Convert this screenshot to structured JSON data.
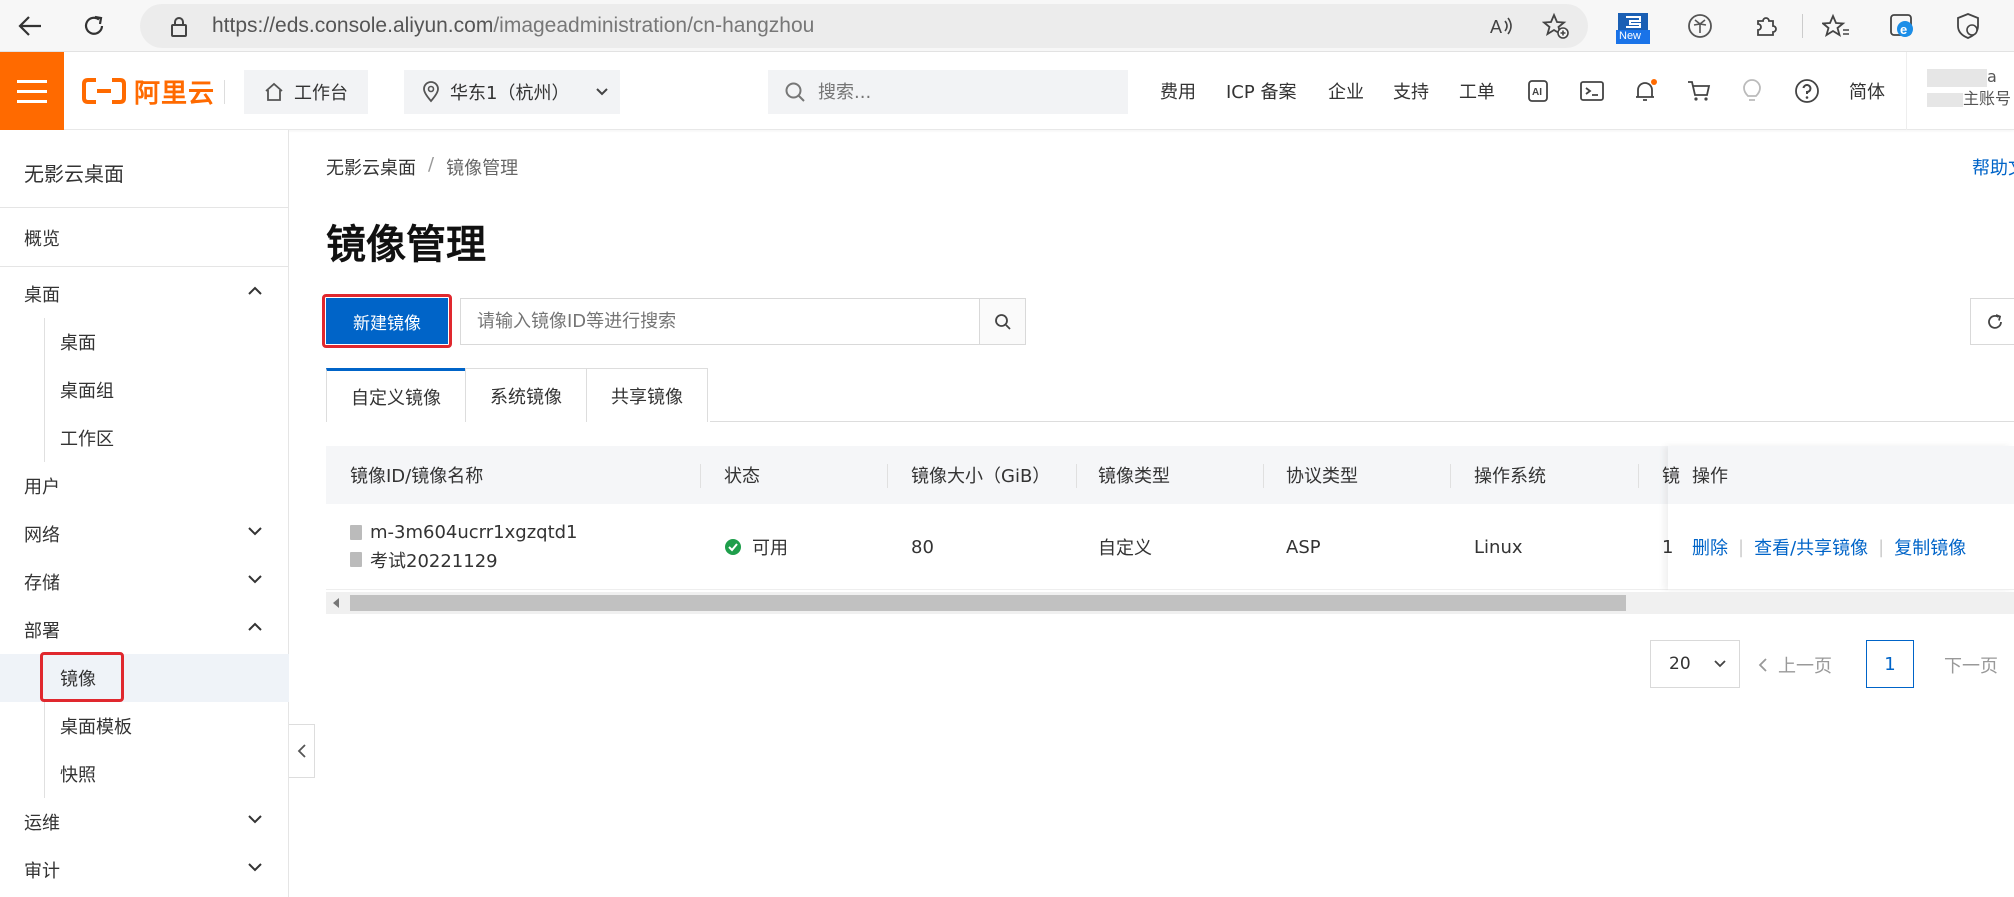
{
  "browser": {
    "url_host": "https://eds.console.aliyun.com",
    "url_path": "/imageadministration/cn-hangzhou",
    "new_badge": "New"
  },
  "topbar": {
    "logo_text": "阿里云",
    "workbench": "工作台",
    "region": "华东1（杭州）",
    "search_placeholder": "搜索...",
    "nav": [
      "费用",
      "ICP 备案",
      "企业",
      "支持",
      "工单"
    ],
    "lang": "简体",
    "account_line1": "a",
    "account_line2": "主账号"
  },
  "sidebar": {
    "title": "无影云桌面",
    "items": [
      {
        "label": "概览"
      },
      {
        "label": "桌面"
      },
      {
        "label": "桌面"
      },
      {
        "label": "桌面组"
      },
      {
        "label": "工作区"
      },
      {
        "label": "用户"
      },
      {
        "label": "网络"
      },
      {
        "label": "存储"
      },
      {
        "label": "部署"
      },
      {
        "label": "镜像"
      },
      {
        "label": "桌面模板"
      },
      {
        "label": "快照"
      },
      {
        "label": "运维"
      },
      {
        "label": "审计"
      }
    ]
  },
  "main": {
    "breadcrumb": [
      "无影云桌面",
      "镜像管理"
    ],
    "breadcrumb_sep": "/",
    "help": "帮助文",
    "title": "镜像管理",
    "new_button": "新建镜像",
    "search_placeholder": "请输入镜像ID等进行搜索",
    "tabs": [
      "自定义镜像",
      "系统镜像",
      "共享镜像"
    ],
    "columns": [
      "镜像ID/镜像名称",
      "状态",
      "镜像大小（GiB）",
      "镜像类型",
      "协议类型",
      "操作系统",
      "镜",
      "操作"
    ],
    "rows": [
      {
        "id": "m-3m604ucrr1xgzqtd1",
        "name": "考试20221129",
        "status": "可用",
        "size": "80",
        "type": "自定义",
        "protocol": "ASP",
        "os": "Linux",
        "extra": "1",
        "actions": [
          "删除",
          "查看/共享镜像",
          "复制镜像"
        ]
      }
    ],
    "pager": {
      "page_size": "20",
      "prev": "上一页",
      "current": "1",
      "next": "下一页"
    }
  },
  "colors": {
    "brand_orange": "#ff6a00",
    "primary_blue": "#0064c8",
    "highlight_red": "#e0282e",
    "status_green": "#1e9e4b"
  }
}
